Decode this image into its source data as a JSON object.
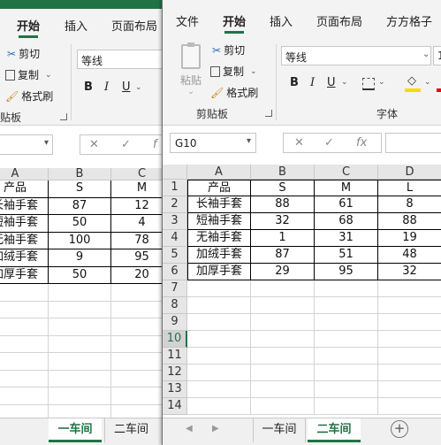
{
  "back": {
    "tabs": [
      "开始",
      "插入",
      "页面布局"
    ],
    "clipboard": {
      "cut": "剪切",
      "copy": "复制",
      "format_painter": "格式刷",
      "group": "贴板"
    },
    "font_name": "等线",
    "fmt": [
      "B",
      "I",
      "U"
    ],
    "columns": [
      "A",
      "B",
      "C"
    ],
    "rows": [
      [
        "产品",
        "S",
        "M"
      ],
      [
        "长袖手套",
        "87",
        "12"
      ],
      [
        "短袖手套",
        "50",
        "4"
      ],
      [
        "无袖手套",
        "100",
        "78"
      ],
      [
        "加绒手套",
        "9",
        "95"
      ],
      [
        "加厚手套",
        "50",
        "20"
      ]
    ],
    "sheets": [
      "一车间",
      "二车间"
    ]
  },
  "front": {
    "tabs": [
      "文件",
      "开始",
      "插入",
      "页面布局",
      "方方格子"
    ],
    "clipboard": {
      "paste": "粘贴",
      "cut": "剪切",
      "copy": "复制",
      "format_painter": "格式刷",
      "group": "剪贴板"
    },
    "font_name": "等线",
    "font_size": "1",
    "font_group": "字体",
    "fmt": [
      "B",
      "I",
      "U"
    ],
    "name_box": "G10",
    "fx": "fx",
    "columns": [
      "A",
      "B",
      "C",
      "D"
    ],
    "row_numbers": [
      "1",
      "2",
      "3",
      "4",
      "5",
      "6",
      "7",
      "8",
      "9",
      "10",
      "11",
      "12",
      "13",
      "14"
    ],
    "selected_row": "10",
    "rows": [
      [
        "产品",
        "S",
        "M",
        "L"
      ],
      [
        "长袖手套",
        "88",
        "61",
        "8"
      ],
      [
        "短袖手套",
        "32",
        "68",
        "88"
      ],
      [
        "无袖手套",
        "1",
        "31",
        "19"
      ],
      [
        "加绒手套",
        "87",
        "51",
        "48"
      ],
      [
        "加厚手套",
        "29",
        "95",
        "32"
      ]
    ],
    "sheets": [
      "一车间",
      "二车间"
    ],
    "active_sheet": "二车间",
    "add_sheet": "+"
  },
  "colors": {
    "excel_green": "#217346",
    "fill_yellow": "#ffd800"
  }
}
